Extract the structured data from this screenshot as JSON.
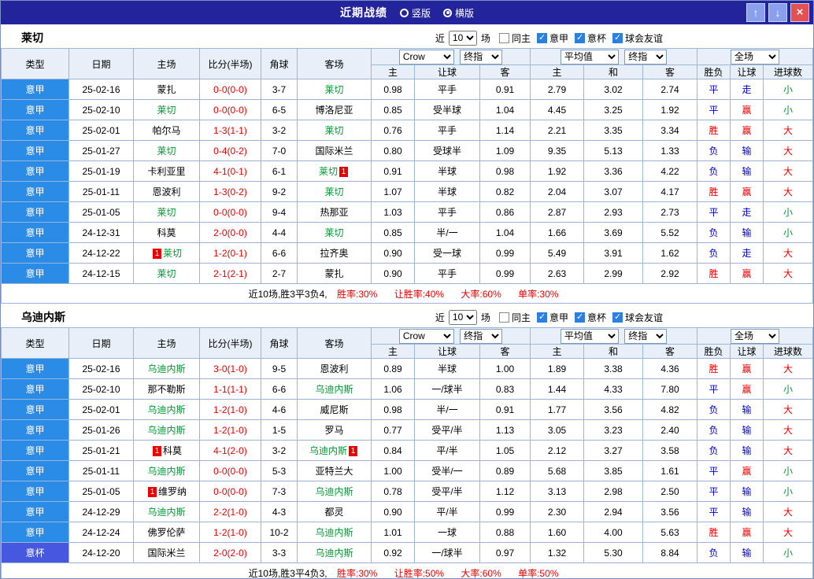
{
  "titlebar": {
    "title": "近期战绩",
    "options": [
      {
        "label": "竖版",
        "checked": false
      },
      {
        "label": "横版",
        "checked": true
      }
    ],
    "buttons": {
      "up": "↑",
      "down": "↓",
      "close": "×"
    }
  },
  "filters": {
    "near": "近",
    "count": "10",
    "games": "场",
    "checkboxes": [
      {
        "label": "同主",
        "checked": false
      },
      {
        "label": "意甲",
        "checked": true
      },
      {
        "label": "意杯",
        "checked": true
      },
      {
        "label": "球会友谊",
        "checked": true
      }
    ]
  },
  "header": {
    "left": [
      "类型",
      "日期",
      "主场",
      "比分(半场)",
      "角球",
      "客场"
    ],
    "odds_group": {
      "bookmaker": "Crow",
      "final": "终指",
      "cols": [
        "主",
        "让球",
        "客"
      ]
    },
    "avg_group": {
      "name": "平均值",
      "final": "终指",
      "cols": [
        "主",
        "和",
        "客"
      ]
    },
    "result_group": {
      "name": "全场",
      "cols": [
        "胜负",
        "让球",
        "进球数"
      ]
    }
  },
  "colors": {
    "navy": "#23239b",
    "league": "#2b8ce8",
    "cup": "#4758e0",
    "red": "#e60000",
    "blue": "#0000cc",
    "green": "#009933",
    "grid": "#9cb6d9",
    "header_bg": "#e8eff9"
  },
  "tables": [
    {
      "team": "莱切",
      "summary": {
        "prefix": "近10场,胜3平3负4,",
        "stats": [
          "胜率:30%",
          "让胜率:40%",
          "大率:60%",
          "单率:30%"
        ]
      },
      "rows": [
        {
          "league": "意甲",
          "date": "25-02-16",
          "home": "蒙扎",
          "home_focal": false,
          "score": "0-0(0-0)",
          "corners": "3-7",
          "away": "莱切",
          "away_focal": true,
          "odds": [
            "0.98",
            "平手",
            "0.91"
          ],
          "avg": [
            "2.79",
            "3.02",
            "2.74"
          ],
          "results": [
            {
              "t": "平",
              "c": "blue"
            },
            {
              "t": "走",
              "c": "blue"
            },
            {
              "t": "小",
              "c": "green"
            }
          ]
        },
        {
          "league": "意甲",
          "date": "25-02-10",
          "home": "莱切",
          "home_focal": true,
          "score": "0-0(0-0)",
          "corners": "6-5",
          "away": "博洛尼亚",
          "away_focal": false,
          "odds": [
            "0.85",
            "受半球",
            "1.04"
          ],
          "avg": [
            "4.45",
            "3.25",
            "1.92"
          ],
          "results": [
            {
              "t": "平",
              "c": "blue"
            },
            {
              "t": "赢",
              "c": "red"
            },
            {
              "t": "小",
              "c": "green"
            }
          ]
        },
        {
          "league": "意甲",
          "date": "25-02-01",
          "home": "帕尔马",
          "home_focal": false,
          "score": "1-3(1-1)",
          "corners": "3-2",
          "away": "莱切",
          "away_focal": true,
          "odds": [
            "0.76",
            "平手",
            "1.14"
          ],
          "avg": [
            "2.21",
            "3.35",
            "3.34"
          ],
          "results": [
            {
              "t": "胜",
              "c": "red"
            },
            {
              "t": "赢",
              "c": "red"
            },
            {
              "t": "大",
              "c": "red"
            }
          ]
        },
        {
          "league": "意甲",
          "date": "25-01-27",
          "home": "莱切",
          "home_focal": true,
          "score": "0-4(0-2)",
          "corners": "7-0",
          "away": "国际米兰",
          "away_focal": false,
          "odds": [
            "0.80",
            "受球半",
            "1.09"
          ],
          "avg": [
            "9.35",
            "5.13",
            "1.33"
          ],
          "results": [
            {
              "t": "负",
              "c": "blue"
            },
            {
              "t": "输",
              "c": "blue"
            },
            {
              "t": "大",
              "c": "red"
            }
          ]
        },
        {
          "league": "意甲",
          "date": "25-01-19",
          "home": "卡利亚里",
          "home_focal": false,
          "score": "4-1(0-1)",
          "corners": "6-1",
          "away": "莱切",
          "away_focal": true,
          "away_card": "1",
          "odds": [
            "0.91",
            "半球",
            "0.98"
          ],
          "avg": [
            "1.92",
            "3.36",
            "4.22"
          ],
          "results": [
            {
              "t": "负",
              "c": "blue"
            },
            {
              "t": "输",
              "c": "blue"
            },
            {
              "t": "大",
              "c": "red"
            }
          ]
        },
        {
          "league": "意甲",
          "date": "25-01-11",
          "home": "恩波利",
          "home_focal": false,
          "score": "1-3(0-2)",
          "corners": "9-2",
          "away": "莱切",
          "away_focal": true,
          "odds": [
            "1.07",
            "半球",
            "0.82"
          ],
          "avg": [
            "2.04",
            "3.07",
            "4.17"
          ],
          "results": [
            {
              "t": "胜",
              "c": "red"
            },
            {
              "t": "赢",
              "c": "red"
            },
            {
              "t": "大",
              "c": "red"
            }
          ]
        },
        {
          "league": "意甲",
          "date": "25-01-05",
          "home": "莱切",
          "home_focal": true,
          "score": "0-0(0-0)",
          "corners": "9-4",
          "away": "热那亚",
          "away_focal": false,
          "odds": [
            "1.03",
            "平手",
            "0.86"
          ],
          "avg": [
            "2.87",
            "2.93",
            "2.73"
          ],
          "results": [
            {
              "t": "平",
              "c": "blue"
            },
            {
              "t": "走",
              "c": "blue"
            },
            {
              "t": "小",
              "c": "green"
            }
          ]
        },
        {
          "league": "意甲",
          "date": "24-12-31",
          "home": "科莫",
          "home_focal": false,
          "score": "2-0(0-0)",
          "corners": "4-4",
          "away": "莱切",
          "away_focal": true,
          "odds": [
            "0.85",
            "半/一",
            "1.04"
          ],
          "avg": [
            "1.66",
            "3.69",
            "5.52"
          ],
          "results": [
            {
              "t": "负",
              "c": "blue"
            },
            {
              "t": "输",
              "c": "blue"
            },
            {
              "t": "小",
              "c": "green"
            }
          ]
        },
        {
          "league": "意甲",
          "date": "24-12-22",
          "home": "莱切",
          "home_focal": true,
          "home_card": "1",
          "score": "1-2(0-1)",
          "corners": "6-6",
          "away": "拉齐奥",
          "away_focal": false,
          "odds": [
            "0.90",
            "受一球",
            "0.99"
          ],
          "avg": [
            "5.49",
            "3.91",
            "1.62"
          ],
          "results": [
            {
              "t": "负",
              "c": "blue"
            },
            {
              "t": "走",
              "c": "blue"
            },
            {
              "t": "大",
              "c": "red"
            }
          ]
        },
        {
          "league": "意甲",
          "date": "24-12-15",
          "home": "莱切",
          "home_focal": true,
          "score": "2-1(2-1)",
          "corners": "2-7",
          "away": "蒙扎",
          "away_focal": false,
          "odds": [
            "0.90",
            "平手",
            "0.99"
          ],
          "avg": [
            "2.63",
            "2.99",
            "2.92"
          ],
          "results": [
            {
              "t": "胜",
              "c": "red"
            },
            {
              "t": "赢",
              "c": "red"
            },
            {
              "t": "大",
              "c": "red"
            }
          ]
        }
      ]
    },
    {
      "team": "乌迪内斯",
      "summary": {
        "prefix": "近10场,胜3平4负3,",
        "stats": [
          "胜率:30%",
          "让胜率:50%",
          "大率:60%",
          "单率:50%"
        ]
      },
      "rows": [
        {
          "league": "意甲",
          "date": "25-02-16",
          "home": "乌迪内斯",
          "home_focal": true,
          "score": "3-0(1-0)",
          "corners": "9-5",
          "away": "恩波利",
          "away_focal": false,
          "odds": [
            "0.89",
            "半球",
            "1.00"
          ],
          "avg": [
            "1.89",
            "3.38",
            "4.36"
          ],
          "results": [
            {
              "t": "胜",
              "c": "red"
            },
            {
              "t": "赢",
              "c": "red"
            },
            {
              "t": "大",
              "c": "red"
            }
          ]
        },
        {
          "league": "意甲",
          "date": "25-02-10",
          "home": "那不勒斯",
          "home_focal": false,
          "score": "1-1(1-1)",
          "corners": "6-6",
          "away": "乌迪内斯",
          "away_focal": true,
          "odds": [
            "1.06",
            "一/球半",
            "0.83"
          ],
          "avg": [
            "1.44",
            "4.33",
            "7.80"
          ],
          "results": [
            {
              "t": "平",
              "c": "blue"
            },
            {
              "t": "赢",
              "c": "red"
            },
            {
              "t": "小",
              "c": "green"
            }
          ]
        },
        {
          "league": "意甲",
          "date": "25-02-01",
          "home": "乌迪内斯",
          "home_focal": true,
          "score": "1-2(1-0)",
          "corners": "4-6",
          "away": "威尼斯",
          "away_focal": false,
          "odds": [
            "0.98",
            "半/一",
            "0.91"
          ],
          "avg": [
            "1.77",
            "3.56",
            "4.82"
          ],
          "results": [
            {
              "t": "负",
              "c": "blue"
            },
            {
              "t": "输",
              "c": "blue"
            },
            {
              "t": "大",
              "c": "red"
            }
          ]
        },
        {
          "league": "意甲",
          "date": "25-01-26",
          "home": "乌迪内斯",
          "home_focal": true,
          "score": "1-2(1-0)",
          "corners": "1-5",
          "away": "罗马",
          "away_focal": false,
          "odds": [
            "0.77",
            "受平/半",
            "1.13"
          ],
          "avg": [
            "3.05",
            "3.23",
            "2.40"
          ],
          "results": [
            {
              "t": "负",
              "c": "blue"
            },
            {
              "t": "输",
              "c": "blue"
            },
            {
              "t": "大",
              "c": "red"
            }
          ]
        },
        {
          "league": "意甲",
          "date": "25-01-21",
          "home": "科莫",
          "home_focal": false,
          "home_card": "1",
          "score": "4-1(2-0)",
          "corners": "3-2",
          "away": "乌迪内斯",
          "away_focal": true,
          "away_card": "1",
          "odds": [
            "0.84",
            "平/半",
            "1.05"
          ],
          "avg": [
            "2.12",
            "3.27",
            "3.58"
          ],
          "results": [
            {
              "t": "负",
              "c": "blue"
            },
            {
              "t": "输",
              "c": "blue"
            },
            {
              "t": "大",
              "c": "red"
            }
          ]
        },
        {
          "league": "意甲",
          "date": "25-01-11",
          "home": "乌迪内斯",
          "home_focal": true,
          "score": "0-0(0-0)",
          "corners": "5-3",
          "away": "亚特兰大",
          "away_focal": false,
          "odds": [
            "1.00",
            "受半/一",
            "0.89"
          ],
          "avg": [
            "5.68",
            "3.85",
            "1.61"
          ],
          "results": [
            {
              "t": "平",
              "c": "blue"
            },
            {
              "t": "赢",
              "c": "red"
            },
            {
              "t": "小",
              "c": "green"
            }
          ]
        },
        {
          "league": "意甲",
          "date": "25-01-05",
          "home": "维罗纳",
          "home_focal": false,
          "home_card": "1",
          "score": "0-0(0-0)",
          "corners": "7-3",
          "away": "乌迪内斯",
          "away_focal": true,
          "odds": [
            "0.78",
            "受平/半",
            "1.12"
          ],
          "avg": [
            "3.13",
            "2.98",
            "2.50"
          ],
          "results": [
            {
              "t": "平",
              "c": "blue"
            },
            {
              "t": "输",
              "c": "blue"
            },
            {
              "t": "小",
              "c": "green"
            }
          ]
        },
        {
          "league": "意甲",
          "date": "24-12-29",
          "home": "乌迪内斯",
          "home_focal": true,
          "score": "2-2(1-0)",
          "corners": "4-3",
          "away": "都灵",
          "away_focal": false,
          "odds": [
            "0.90",
            "平/半",
            "0.99"
          ],
          "avg": [
            "2.30",
            "2.94",
            "3.56"
          ],
          "results": [
            {
              "t": "平",
              "c": "blue"
            },
            {
              "t": "输",
              "c": "blue"
            },
            {
              "t": "大",
              "c": "red"
            }
          ]
        },
        {
          "league": "意甲",
          "date": "24-12-24",
          "home": "佛罗伦萨",
          "home_focal": false,
          "score": "1-2(1-0)",
          "corners": "10-2",
          "away": "乌迪内斯",
          "away_focal": true,
          "odds": [
            "1.01",
            "一球",
            "0.88"
          ],
          "avg": [
            "1.60",
            "4.00",
            "5.63"
          ],
          "results": [
            {
              "t": "胜",
              "c": "red"
            },
            {
              "t": "赢",
              "c": "red"
            },
            {
              "t": "大",
              "c": "red"
            }
          ]
        },
        {
          "league": "意杯",
          "cup": true,
          "date": "24-12-20",
          "home": "国际米兰",
          "home_focal": false,
          "score": "2-0(2-0)",
          "corners": "3-3",
          "away": "乌迪内斯",
          "away_focal": true,
          "odds": [
            "0.92",
            "一/球半",
            "0.97"
          ],
          "avg": [
            "1.32",
            "5.30",
            "8.84"
          ],
          "results": [
            {
              "t": "负",
              "c": "blue"
            },
            {
              "t": "输",
              "c": "blue"
            },
            {
              "t": "小",
              "c": "green"
            }
          ]
        }
      ]
    }
  ]
}
